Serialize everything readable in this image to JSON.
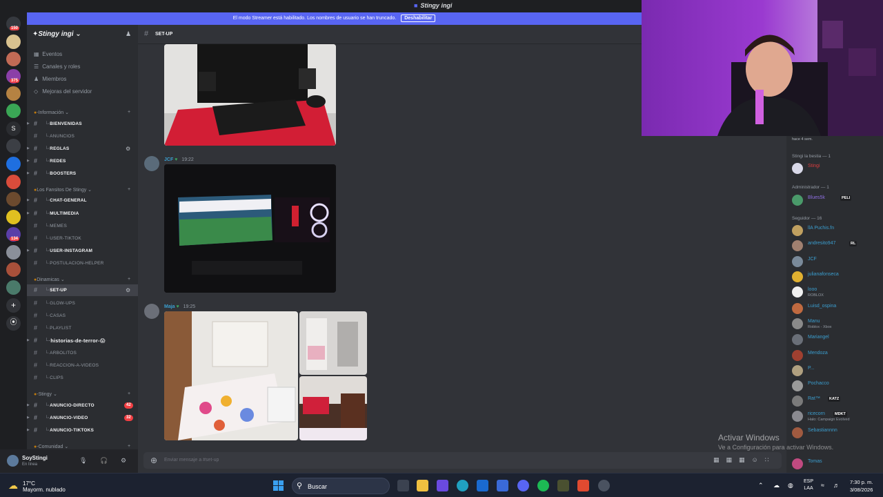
{
  "window": {
    "title": "Stingy ingi"
  },
  "banner": {
    "text": "El modo Streamer está habilitado. Los nombres de usuario se han truncado.",
    "button": "Deshabilitar"
  },
  "rail": {
    "badges": [
      "150",
      "375",
      "134"
    ],
    "letter": "S"
  },
  "sidebar": {
    "guild": "Stingy ingi",
    "top_items": [
      {
        "label": "Eventos",
        "icon": "calendar-icon"
      },
      {
        "label": "Canales y roles",
        "icon": "channels-icon"
      },
      {
        "label": "Miembros",
        "icon": "members-icon"
      },
      {
        "label": "Mejoras del servidor",
        "icon": "boost-icon"
      }
    ],
    "categories": [
      "-Información",
      "Los Fansitos De Stingy",
      "Dinamicas",
      "-Stingy",
      "-Comunidad"
    ],
    "channels": [
      {
        "name": "bienvenidas"
      },
      {
        "name": "anuncios"
      },
      {
        "name": "reglas"
      },
      {
        "name": "redes"
      },
      {
        "name": "boosters"
      },
      {
        "name": "chat-general"
      },
      {
        "name": "multimedia"
      },
      {
        "name": "memes"
      },
      {
        "name": "user-tiktok"
      },
      {
        "name": "user-instagram"
      },
      {
        "name": "postulacion-helper"
      },
      {
        "name": "set-up"
      },
      {
        "name": "glow-ups"
      },
      {
        "name": "casas"
      },
      {
        "name": "playlist"
      },
      {
        "name": "historias-de-terror-😱"
      },
      {
        "name": "arbolitos"
      },
      {
        "name": "reaccion-a-videos"
      },
      {
        "name": "clips"
      },
      {
        "name": "anuncio-directo",
        "mentions": "42"
      },
      {
        "name": "anuncio-video",
        "mentions": "32"
      },
      {
        "name": "anuncio-tiktoks"
      }
    ]
  },
  "user": {
    "name": "SoyStingi",
    "status": "En línea"
  },
  "header": {
    "channel": "set-up"
  },
  "messages": [
    {
      "author": "JCF",
      "time": "19:22"
    },
    {
      "author": "Maja",
      "time": "19:25"
    }
  ],
  "composer": {
    "placeholder": "Enviar mensaje a #",
    "channel": "set-up"
  },
  "members": {
    "top_note": "hace 4 sem.",
    "groups": [
      {
        "label": "Stingi la bestia — 1"
      },
      {
        "label": "Administrador — 1"
      },
      {
        "label": "Seguidor — 16"
      }
    ],
    "list": [
      {
        "name": "Stingi",
        "color": "red"
      },
      {
        "name": "Blues5k",
        "tag": "PELI",
        "color": "purple"
      },
      {
        "name": "llA Puchis.fn"
      },
      {
        "name": "andresito947",
        "tag": "RL"
      },
      {
        "name": "JCF"
      },
      {
        "name": "julianafonseca"
      },
      {
        "name": "looo",
        "sub": "ROBLOX"
      },
      {
        "name": "Luisd_ospina"
      },
      {
        "name": "Manu",
        "sub": "Roblox - Xbox"
      },
      {
        "name": "Mariangel"
      },
      {
        "name": "Mendoza"
      },
      {
        "name": "P..."
      },
      {
        "name": "Pochacco"
      },
      {
        "name": "Rat™",
        "tag": "KATZ"
      },
      {
        "name": "ricecorn",
        "tag": "MDKT",
        "sub": "Halo: Campaign Evolved"
      },
      {
        "name": "Sebastiannnn"
      },
      {
        "name": "Tomas"
      }
    ]
  },
  "watermark": {
    "line1": "Activar Windows",
    "line2": "Ve a Configuración para activar Windows."
  },
  "taskbar": {
    "temp": "17°C",
    "weather": "Mayorm. nublado",
    "search": "Buscar",
    "lang1": "ESP",
    "lang2": "LAA",
    "time": "7:30 p. m.",
    "date": "3/08/2026"
  },
  "colors": {
    "accent": "#5865f2",
    "link": "#3b9ecf",
    "mention": "#f23f43"
  }
}
